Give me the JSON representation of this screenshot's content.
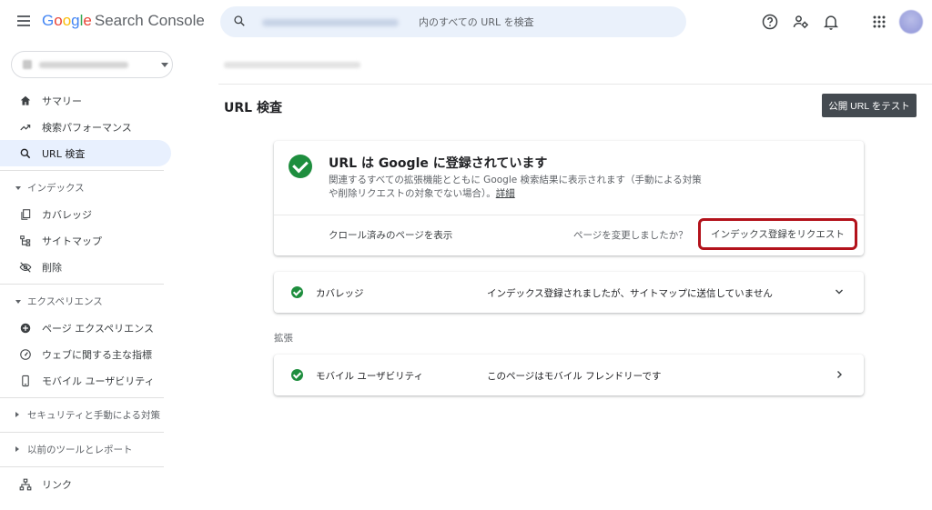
{
  "app": {
    "logo_google": [
      "G",
      "o",
      "o",
      "g",
      "l",
      "e"
    ],
    "logo_colors": [
      "#4285F4",
      "#EA4335",
      "#FBBC05",
      "#4285F4",
      "#34A853",
      "#EA4335"
    ],
    "logo_suffix": "Search Console"
  },
  "search": {
    "placeholder": "内のすべての URL を検査"
  },
  "sidebar": {
    "items_top": [
      {
        "label": "サマリー",
        "icon": "home-icon"
      },
      {
        "label": "検索パフォーマンス",
        "icon": "trending-up-icon"
      },
      {
        "label": "URL 検査",
        "icon": "search-icon",
        "active": true
      }
    ],
    "index_section": "インデックス",
    "index_items": [
      {
        "label": "カバレッジ",
        "icon": "copy-pages-icon"
      },
      {
        "label": "サイトマップ",
        "icon": "sitemap-icon"
      },
      {
        "label": "削除",
        "icon": "eye-off-icon"
      }
    ],
    "experience_section": "エクスペリエンス",
    "experience_items": [
      {
        "label": "ページ エクスペリエンス",
        "icon": "add-circle-icon"
      },
      {
        "label": "ウェブに関する主な指標",
        "icon": "speed-gauge-icon"
      },
      {
        "label": "モバイル ユーザビリティ",
        "icon": "smartphone-icon"
      }
    ],
    "security_section": "セキュリティと手動による対策",
    "legacy_section": "以前のツールとレポート",
    "links_item": {
      "label": "リンク",
      "icon": "links-network-icon"
    }
  },
  "main": {
    "title": "URL 検査",
    "test_button": "公開 URL をテスト",
    "status_card": {
      "title": "URL は Google に登録されています",
      "description": "関連するすべての拡張機能とともに Google 検索結果に表示されます（手動による対策や削除リクエストの対象でない場合）。",
      "details_link": "詳細",
      "crawl_link": "クロール済みのページを表示",
      "changed_question": "ページを変更しましたか？",
      "request_button": "インデックス登録をリクエスト"
    },
    "coverage_row": {
      "label": "カバレッジ",
      "value": "インデックス登録されましたが、サイトマップに送信していません"
    },
    "enhancements_label": "拡張",
    "mobile_row": {
      "label": "モバイル ユーザビリティ",
      "value": "このページはモバイル フレンドリーです"
    }
  },
  "colors": {
    "success": "#1e8e3e",
    "highlight_border": "#b3121b",
    "active_nav": "#e8f0fe",
    "dark_button": "#444a50"
  }
}
